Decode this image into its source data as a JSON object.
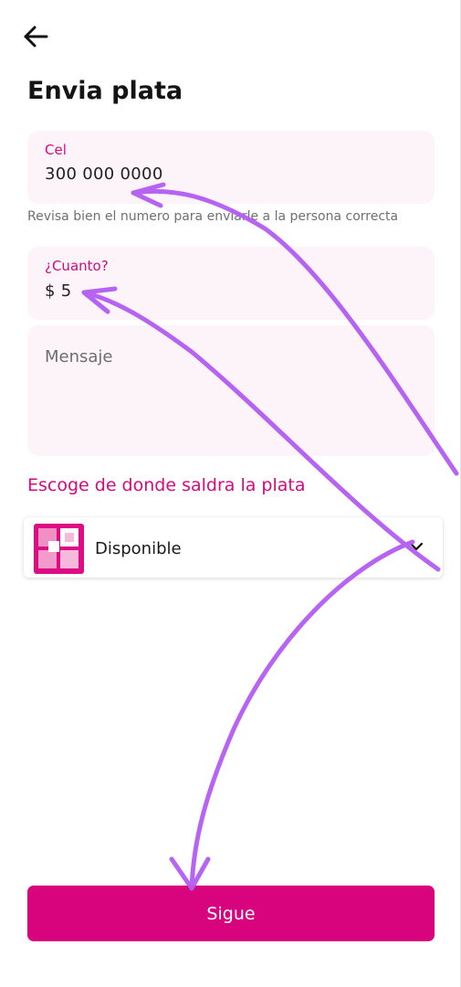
{
  "header": {
    "back_icon": "arrow-left-icon",
    "title": "Envia plata"
  },
  "form": {
    "phone": {
      "label": "Cel",
      "value": "300 000 0000",
      "helper": "Revisa bien el numero para enviarle a la persona correcta"
    },
    "amount": {
      "label": "¿Cuanto?",
      "value": "$ 5"
    },
    "message": {
      "placeholder": "Mensaje"
    }
  },
  "source": {
    "heading": "Escoge de donde saldra la plata",
    "selected": "Disponible",
    "icon": "pocket-logo-icon",
    "chevron": "chevron-down-icon"
  },
  "submit": {
    "label": "Sigue"
  },
  "colors": {
    "accent": "#d8047e",
    "field_bg": "#fdf4fa",
    "annotation": "#b45cf2"
  }
}
